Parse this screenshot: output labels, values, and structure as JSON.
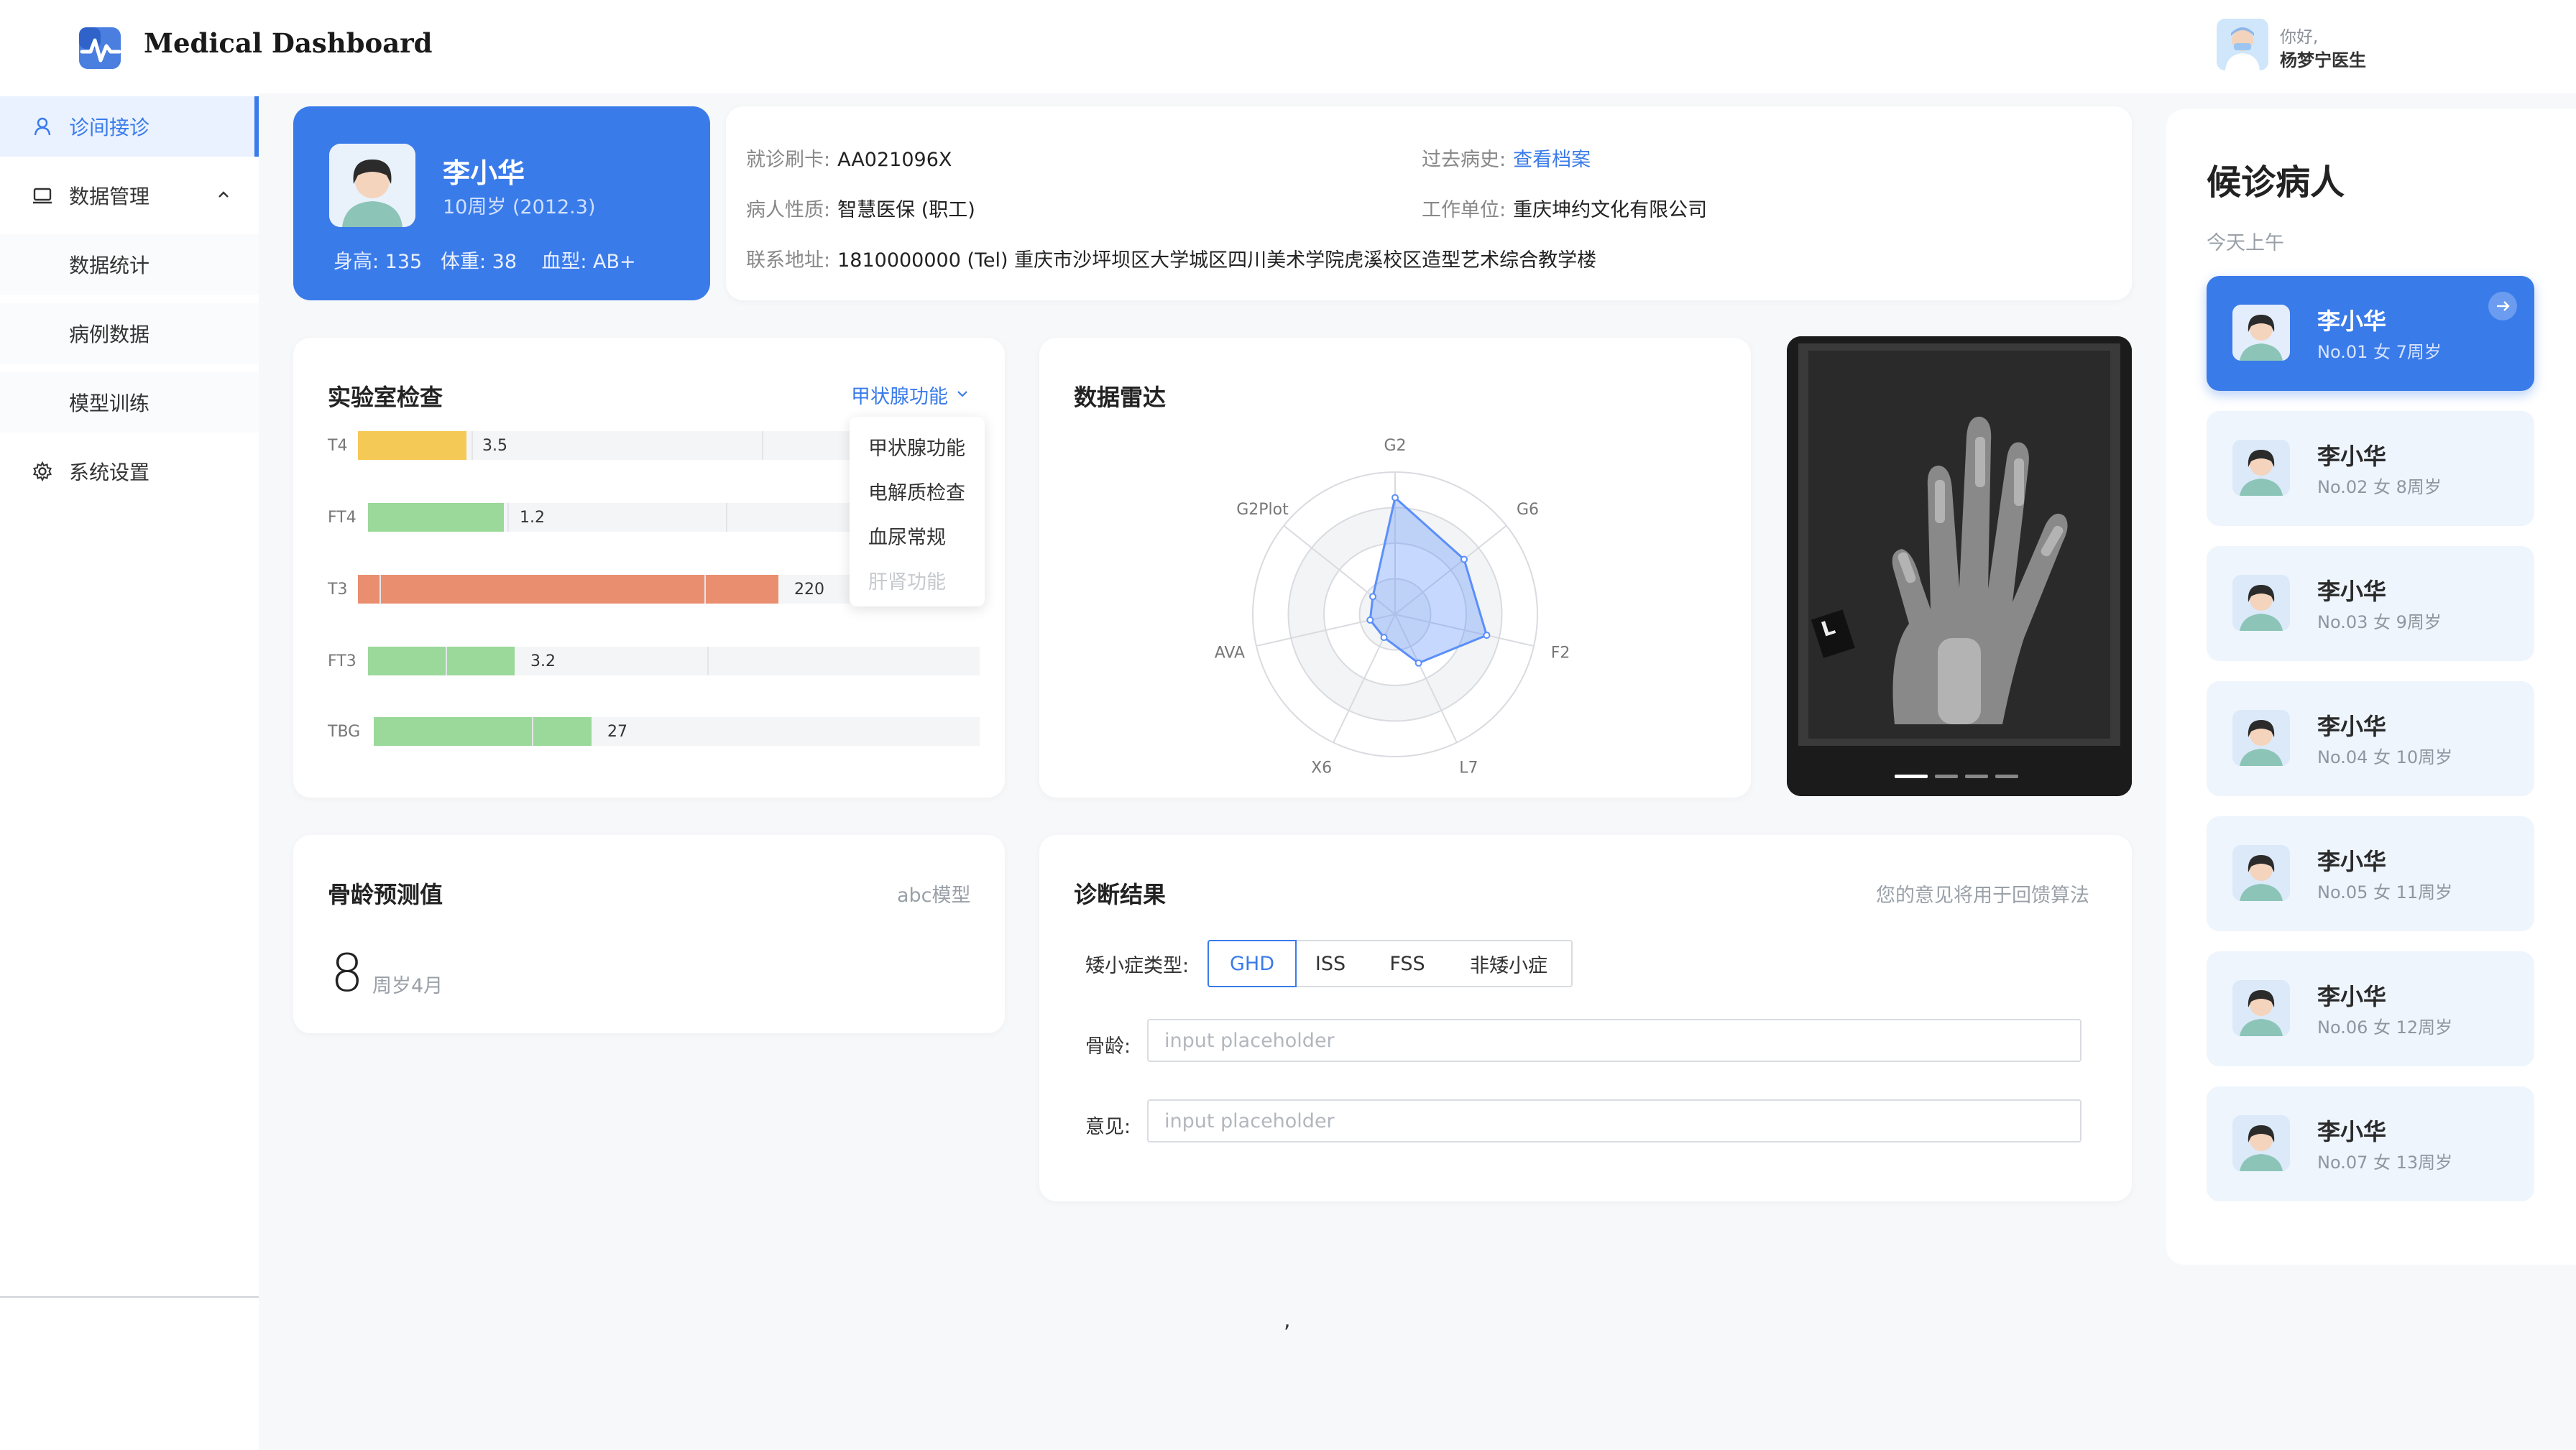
{
  "app": {
    "title": "Medical Dashboard"
  },
  "user": {
    "greeting": "你好,",
    "name": "杨梦宁医生"
  },
  "sidebar": {
    "items": [
      {
        "label": "诊间接诊",
        "icon": "user-icon",
        "active": true
      },
      {
        "label": "数据管理",
        "icon": "monitor-icon",
        "expanded": true
      },
      {
        "label": "数据统计",
        "sub": true
      },
      {
        "label": "病例数据",
        "sub": true
      },
      {
        "label": "模型训练",
        "sub": true
      },
      {
        "label": "系统设置",
        "icon": "gear-icon"
      }
    ]
  },
  "patient": {
    "name": "李小华",
    "age": "10周岁 (2012.3)",
    "vitals": "身高: 135   体重: 38    血型: AB+",
    "info": {
      "card_label": "就诊刷卡:",
      "card_value": "AA021096X",
      "history_label": "过去病史:",
      "history_link": "查看档案",
      "nature_label": "病人性质:",
      "nature_value": "智慧医保 (职工)",
      "work_label": "工作单位:",
      "work_value": "重庆坤约文化有限公司",
      "address_label": "联系地址:",
      "address_value": "1810000000 (Tel) 重庆市沙坪坝区大学城区四川美术学院虎溪校区造型艺术综合教学楼"
    }
  },
  "lab": {
    "title": "实验室检查",
    "selected": "甲状腺功能",
    "options": [
      "甲状腺功能",
      "电解质检查",
      "血尿常规",
      "肝肾功能"
    ],
    "disabled_option": "肝肾功能"
  },
  "chart_data": [
    {
      "type": "bar",
      "orientation": "horizontal",
      "categories": [
        "T4",
        "FT4",
        "T3",
        "FT3",
        "TBG"
      ],
      "values": [
        3.5,
        1.2,
        220,
        3.2,
        27
      ],
      "value_labels": [
        "3.5",
        "1.2",
        "220",
        "3.2",
        "27"
      ],
      "fill_fraction": [
        0.29,
        0.37,
        0.94,
        0.4,
        0.6
      ],
      "colors": [
        "#f5c955",
        "#9ad99a",
        "#e98f6f",
        "#9ad99a",
        "#9ad99a"
      ]
    },
    {
      "type": "radar",
      "title": "数据雷达",
      "axes": [
        "G2",
        "G6",
        "F2",
        "L7",
        "X6",
        "AVA",
        "G2Plot"
      ],
      "values": [
        0.82,
        0.62,
        0.66,
        0.38,
        0.18,
        0.18,
        0.2
      ],
      "color": "#5b8ff9"
    }
  ],
  "radar": {
    "title": "数据雷达"
  },
  "xray": {
    "marker": "L",
    "slides": 4,
    "active_slide": 0
  },
  "bone": {
    "title": "骨龄预测值",
    "model": "abc模型",
    "value": "8",
    "unit": "周岁4月"
  },
  "diagnosis": {
    "title": "诊断结果",
    "hint": "您的意见将用于回馈算法",
    "type_label": "矮小症类型:",
    "types": [
      "GHD",
      "ISS",
      "FSS",
      "非矮小症"
    ],
    "selected_type": "GHD",
    "bone_label": "骨龄:",
    "opinion_label": "意见:",
    "placeholder": "input placeholder"
  },
  "waiting": {
    "title": "候诊病人",
    "subtitle": "今天上午",
    "patients": [
      {
        "name": "李小华",
        "meta": "No.01 女 7周岁"
      },
      {
        "name": "李小华",
        "meta": "No.02 女 8周岁"
      },
      {
        "name": "李小华",
        "meta": "No.03 女 9周岁"
      },
      {
        "name": "李小华",
        "meta": "No.04 女 10周岁"
      },
      {
        "name": "李小华",
        "meta": "No.05 女 11周岁"
      },
      {
        "name": "李小华",
        "meta": "No.06 女 12周岁"
      },
      {
        "name": "李小华",
        "meta": "No.07 女 13周岁"
      }
    ]
  },
  "misc": {
    "stray": ","
  },
  "theme": {
    "accent": "#3a7bea"
  }
}
